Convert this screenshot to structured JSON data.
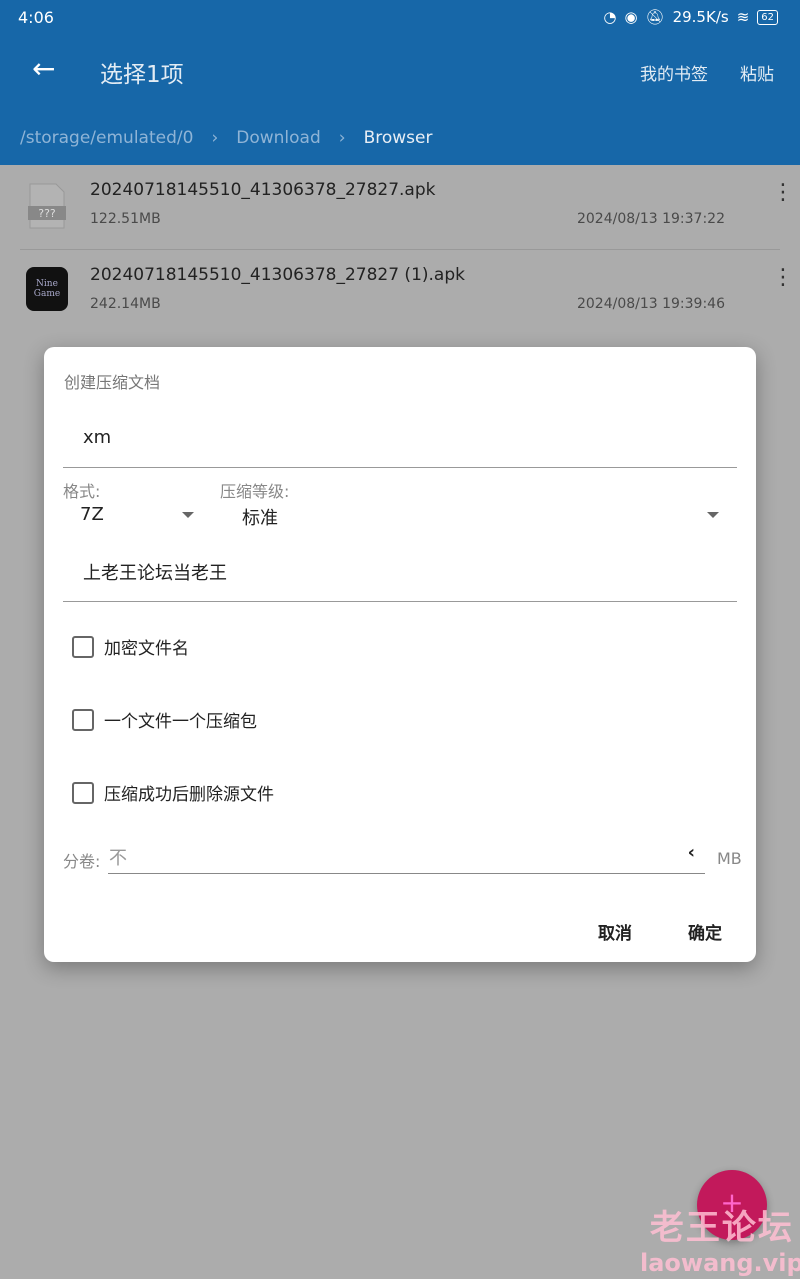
{
  "status": {
    "time": "4:06",
    "speed": "29.5K/s",
    "battery": "62"
  },
  "toolbar": {
    "title": "选择1项",
    "bookmarks": "我的书签",
    "paste": "粘贴"
  },
  "breadcrumb": [
    "/storage/emulated/0",
    "Download",
    "Browser"
  ],
  "files": [
    {
      "name": "20240718145510_41306378_27827.apk",
      "size": "122.51MB",
      "date": "2024/08/13 19:37:22",
      "icon": "unknown-file-icon",
      "icon_text": "???"
    },
    {
      "name": "20240718145510_41306378_27827 (1).apk",
      "size": "242.14MB",
      "date": "2024/08/13 19:39:46",
      "icon": "ninegame-app-icon",
      "icon_text": "Nine Game"
    }
  ],
  "dialog": {
    "title": "创建压缩文档",
    "filename": "xm",
    "format_label": "格式:",
    "format": "7Z",
    "level_label": "压缩等级:",
    "level": "标准",
    "password": "上老王论坛当老王",
    "options": [
      "加密文件名",
      "一个文件一个压缩包",
      "压缩成功后删除源文件"
    ],
    "split_label": "分卷:",
    "split_placeholder": "不",
    "split_unit": "MB",
    "cancel": "取消",
    "ok": "确定"
  },
  "watermark": {
    "line1": "老王论坛",
    "line2": "laowang.vip"
  },
  "colors": {
    "header": "#1767a8",
    "fab": "#c2195b"
  }
}
